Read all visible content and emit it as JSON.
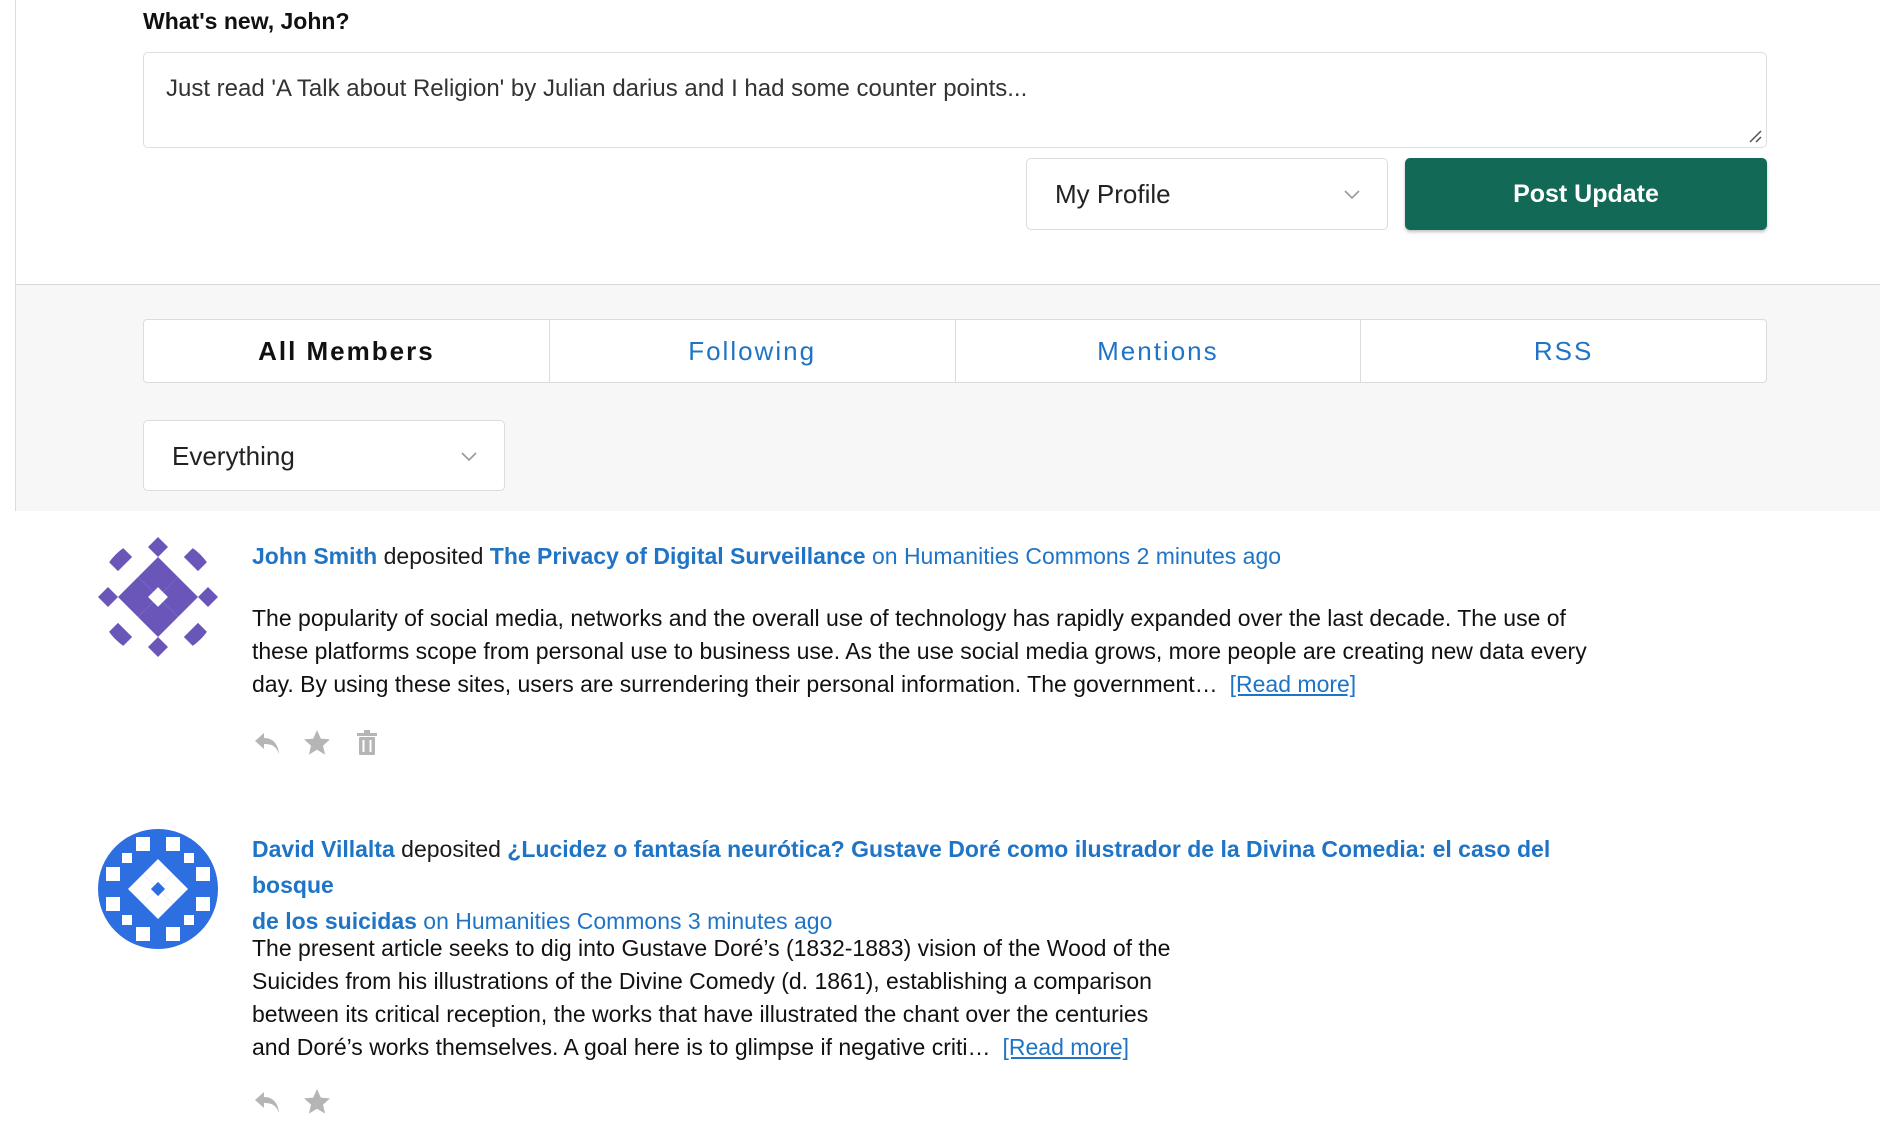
{
  "composer": {
    "prompt": "What's new, John?",
    "text": "Just read 'A Talk about Religion' by Julian darius and I had some counter points...",
    "target_value": "My Profile",
    "post_label": "Post Update"
  },
  "tabs": [
    {
      "label": "All Members",
      "active": true
    },
    {
      "label": "Following",
      "active": false
    },
    {
      "label": "Mentions",
      "active": false
    },
    {
      "label": "RSS",
      "active": false
    }
  ],
  "filter": {
    "value": "Everything"
  },
  "activities": [
    {
      "user": "John Smith",
      "action": "deposited",
      "title": "The Privacy of Digital Surveillance",
      "context": "on Humanities Commons",
      "time": "2 minutes ago",
      "excerpt_lines": [
        "The popularity of social media, networks and the overall use of technology has rapidly expanded over the last decade. The use of",
        "these platforms scope from personal use to business use. As the use social media grows, more people are creating new data every",
        "day. By using these sites, users are surrendering their personal information. The government…"
      ],
      "read_more": "[Read more]",
      "avatar_color": "#6a55b8",
      "actions": [
        "reply-icon",
        "favorite-icon",
        "delete-icon"
      ]
    },
    {
      "user": "David Villalta",
      "action": "deposited",
      "title_line1": "¿Lucidez o fantasía neurótica? Gustave Doré como ilustrador de la Divina Comedia: el caso del bosque",
      "title_line2": "de los suicidas",
      "context": "on Humanities Commons",
      "time": "3 minutes ago",
      "excerpt_lines": [
        "The present article seeks to dig into Gustave Doré’s (1832-1883) vision of the Wood of the",
        "Suicides from his illustrations of the Divine Comedy (d. 1861), establishing a comparison",
        "between its critical reception, the works that have illustrated the chant over the centuries",
        "and Doré’s works themselves. A goal here is to glimpse if negative criti…"
      ],
      "read_more": "[Read more]",
      "avatar_color": "#2d6ee0",
      "actions": [
        "reply-icon",
        "favorite-icon"
      ]
    }
  ]
}
